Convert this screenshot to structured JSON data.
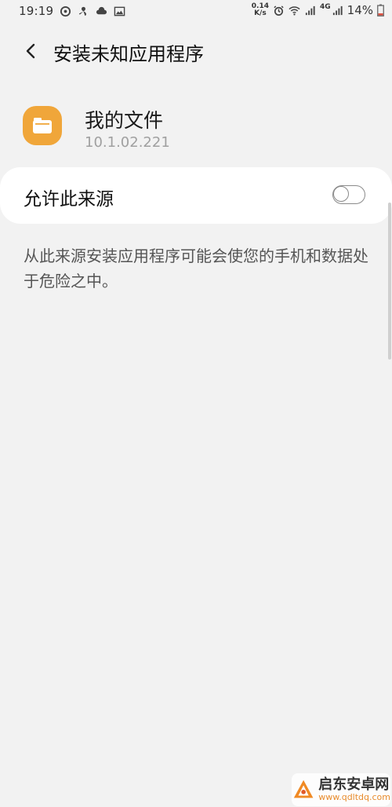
{
  "status_bar": {
    "time": "19:19",
    "net_speed_value": "0.14",
    "net_speed_unit": "K/s",
    "network_type": "4G",
    "battery_percent": "14%",
    "left_icons": [
      "sync-icon",
      "fan-icon",
      "cloud-icon",
      "image-icon"
    ],
    "right_icons": [
      "alarm-icon",
      "wifi-icon",
      "signal-icon",
      "signal-4g-icon",
      "battery-icon"
    ]
  },
  "header": {
    "title": "安装未知应用程序",
    "back_icon": "chevron-left-icon"
  },
  "app": {
    "name": "我的文件",
    "version": "10.1.02.221",
    "icon": "folder-icon",
    "icon_color": "#f0a63a"
  },
  "setting": {
    "label": "允许此来源",
    "enabled": false
  },
  "description": "从此来源安装应用程序可能会使您的手机和数据处于危险之中。",
  "watermark": {
    "title": "启东安卓网",
    "url": "www.qdltdq.com"
  },
  "colors": {
    "background": "#f2f2f2",
    "card": "#ffffff",
    "accent_orange": "#f0a63a",
    "secondary_text": "#a0a0a0"
  }
}
